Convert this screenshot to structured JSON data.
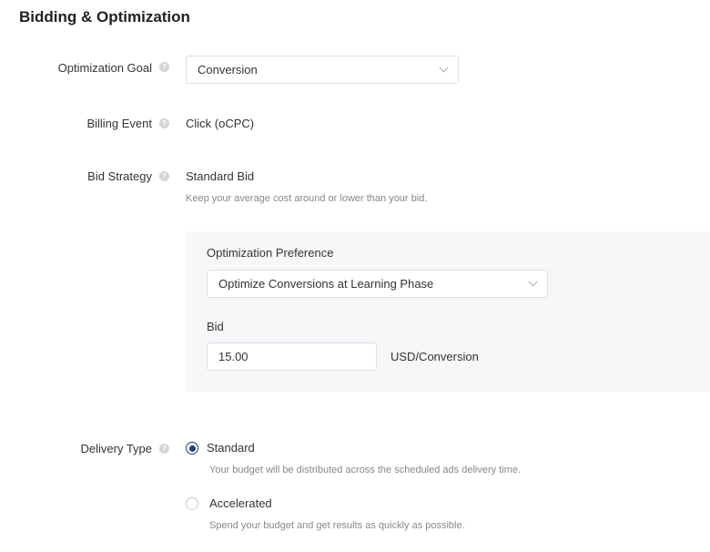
{
  "section_title": "Bidding & Optimization",
  "help_icon": "?",
  "optimization_goal": {
    "label": "Optimization Goal",
    "value": "Conversion"
  },
  "billing_event": {
    "label": "Billing Event",
    "value": "Click (oCPC)"
  },
  "bid_strategy": {
    "label": "Bid Strategy",
    "value": "Standard Bid",
    "description": "Keep your average cost around or lower than your bid."
  },
  "panel": {
    "preference_label": "Optimization Preference",
    "preference_value": "Optimize Conversions at Learning Phase",
    "bid_label": "Bid",
    "bid_value": "15.00",
    "bid_unit": "USD/Conversion"
  },
  "delivery_type": {
    "label": "Delivery Type",
    "options": [
      {
        "label": "Standard",
        "description": "Your budget will be distributed across the scheduled ads delivery time.",
        "selected": true
      },
      {
        "label": "Accelerated",
        "description": "Spend your budget and get results as quickly as possible.",
        "selected": false
      }
    ]
  },
  "colors": {
    "accent": "#1f3f7a",
    "panel_bg": "#f6f7f9"
  }
}
